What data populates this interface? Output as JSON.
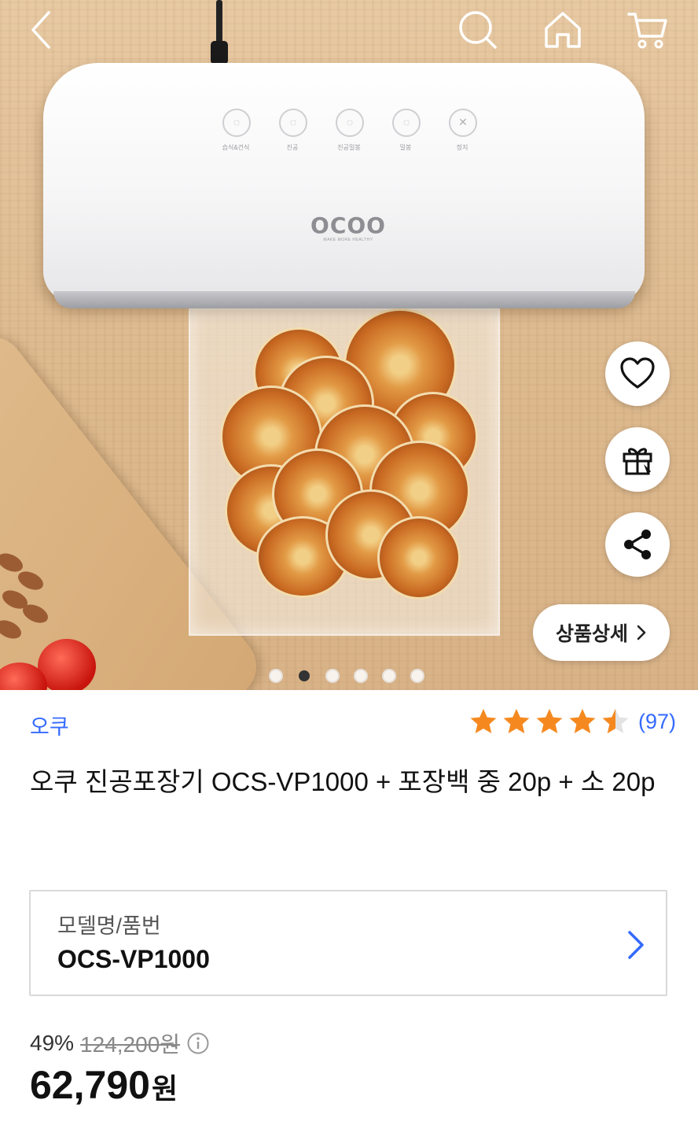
{
  "nav": {
    "back_icon": "chevron-left-icon",
    "search_icon": "search-icon",
    "home_icon": "home-icon",
    "cart_icon": "cart-icon"
  },
  "hero": {
    "device_logo": "OCOO",
    "device_tagline": "MAKE MORE HEALTHY",
    "device_buttons": [
      "습식&건식",
      "진공",
      "진공밀봉",
      "밀봉",
      "정지"
    ],
    "detail_button_label": "상품상세",
    "image_count": 6,
    "active_image_index": 1
  },
  "product": {
    "brand": "오쿠",
    "rating": 4.5,
    "review_count": "(97)",
    "title": "오쿠 진공포장기 OCS-VP1000 + 포장백 중 20p + 소 20p",
    "model_label": "모델명/품번",
    "model_value": "OCS-VP1000",
    "discount_percent": "49%",
    "original_price": "124,200원",
    "price": "62,790",
    "currency": "원"
  },
  "colors": {
    "accent_blue": "#346aff",
    "star_orange": "#f5891f"
  }
}
